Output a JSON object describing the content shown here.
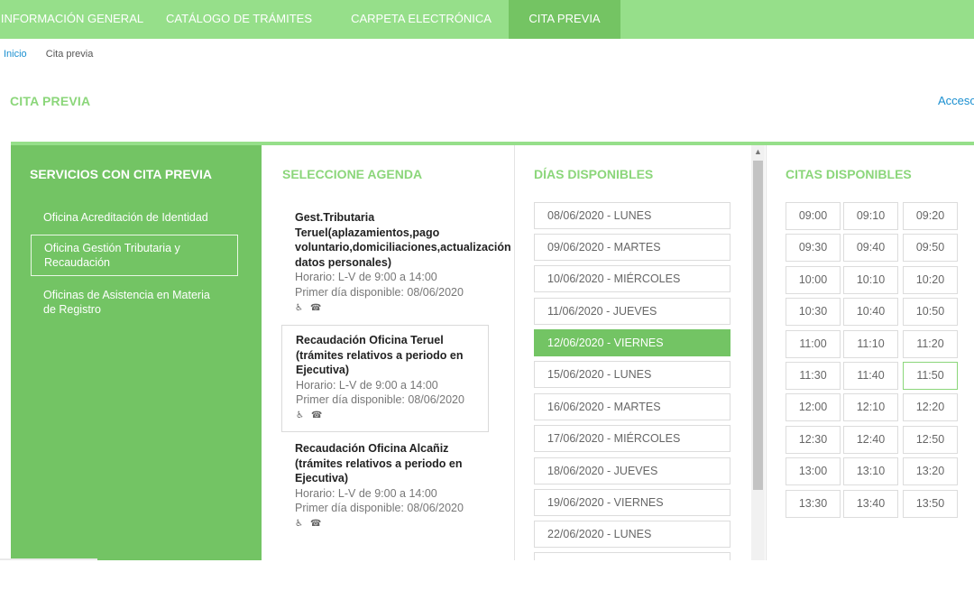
{
  "nav": {
    "items": [
      {
        "label": "INFORMACIÓN GENERAL"
      },
      {
        "label": "CATÁLOGO DE TRÁMITES"
      },
      {
        "label": "CARPETA ELECTRÓNICA"
      },
      {
        "label": "CITA PREVIA",
        "active": true
      }
    ]
  },
  "breadcrumb": {
    "home": "Inicio",
    "current": "Cita previa"
  },
  "page": {
    "title": "CITA PREVIA",
    "access_link": "Acceso"
  },
  "services": {
    "heading": "SERVICIOS CON CITA PREVIA",
    "items": [
      {
        "label": "Oficina Acreditación de Identidad"
      },
      {
        "label": "Oficina Gestión Tributaria y Recaudación",
        "selected": true
      },
      {
        "label": "Oficinas de Asistencia en Materia de Registro"
      }
    ]
  },
  "agenda": {
    "heading": "SELECCIONE AGENDA",
    "items": [
      {
        "name": "Gest.Tributaria Teruel(aplazamientos,pago voluntario,domiciliaciones,actualización datos personales)",
        "schedule": "Horario: L-V de 9:00 a 14:00",
        "first_day": "Primer día disponible: 08/06/2020"
      },
      {
        "name": "Recaudación Oficina Teruel (trámites relativos a periodo en Ejecutiva)",
        "schedule": "Horario: L-V de 9:00 a 14:00",
        "first_day": "Primer día disponible: 08/06/2020",
        "selected": true
      },
      {
        "name": "Recaudación Oficina Alcañiz (trámites relativos a periodo en Ejecutiva)",
        "schedule": "Horario: L-V de 9:00 a 14:00",
        "first_day": "Primer día disponible: 08/06/2020"
      }
    ],
    "icons": [
      "wheelchair-icon",
      "phone-icon"
    ]
  },
  "days": {
    "heading": "DÍAS DISPONIBLES",
    "items": [
      "08/06/2020 - LUNES",
      "09/06/2020 - MARTES",
      "10/06/2020 - MIÉRCOLES",
      "11/06/2020 - JUEVES",
      "12/06/2020 - VIERNES",
      "15/06/2020 - LUNES",
      "16/06/2020 - MARTES",
      "17/06/2020 - MIÉRCOLES",
      "18/06/2020 - JUEVES",
      "19/06/2020 - VIERNES",
      "22/06/2020 - LUNES",
      ""
    ],
    "selected": "12/06/2020 - VIERNES"
  },
  "slots": {
    "heading": "CITAS DISPONIBLES",
    "times": [
      "09:00",
      "09:10",
      "09:20",
      "09:30",
      "09:40",
      "09:50",
      "10:00",
      "10:10",
      "10:20",
      "10:30",
      "10:40",
      "10:50",
      "11:00",
      "11:10",
      "11:20",
      "11:30",
      "11:40",
      "11:50",
      "12:00",
      "12:10",
      "12:20",
      "12:30",
      "12:40",
      "12:50",
      "13:00",
      "13:10",
      "13:20",
      "13:30",
      "13:40",
      "13:50"
    ],
    "selected": "11:50"
  },
  "colors": {
    "nav_bg": "#96df8a",
    "accent": "#73c464",
    "heading": "#8bd67a",
    "link": "#1a8fd0"
  }
}
